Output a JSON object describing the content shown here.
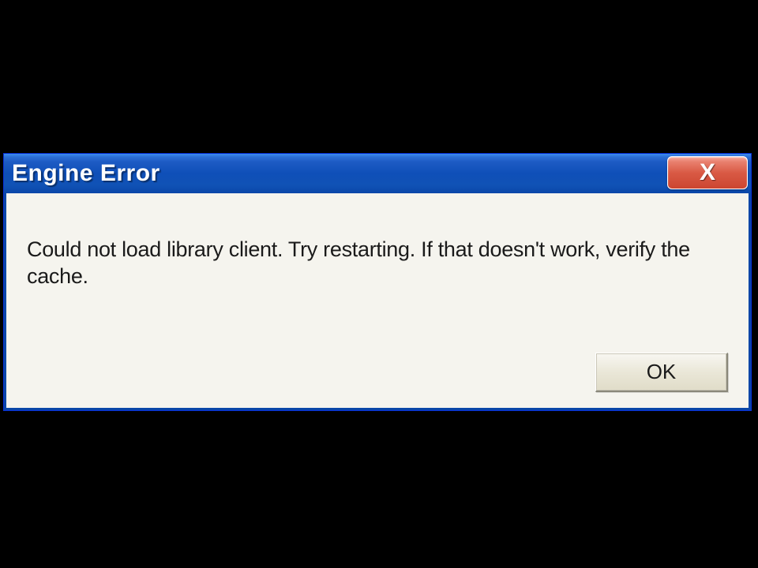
{
  "dialog": {
    "title": "Engine Error",
    "message": "Could not load library client. Try restarting. If that doesn't work, verify the cache.",
    "ok_label": "OK",
    "close_glyph": "X"
  }
}
